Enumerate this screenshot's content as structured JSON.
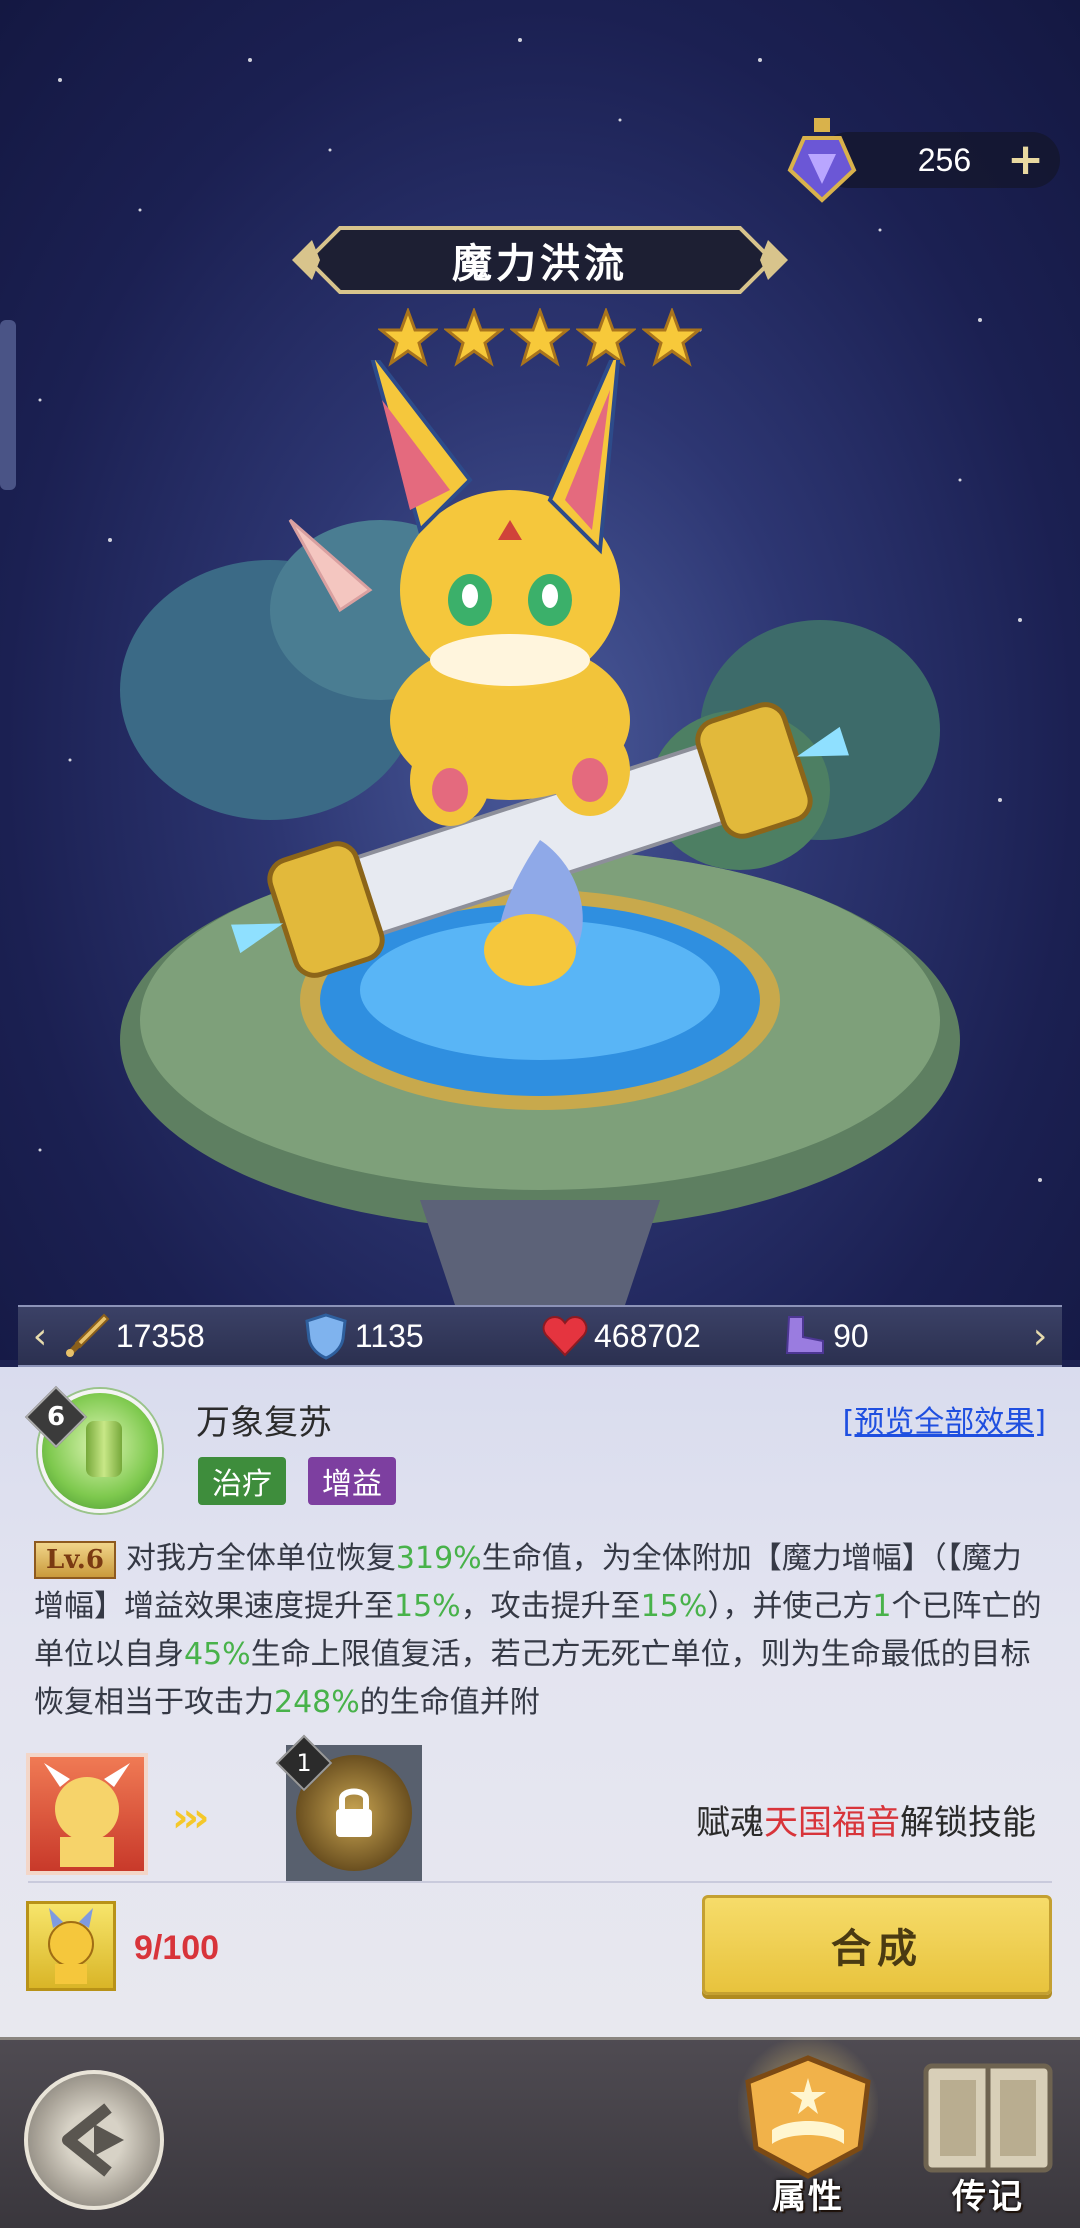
{
  "currency": {
    "amount": "256",
    "icon": "potion-icon",
    "plus_label": "+"
  },
  "hero": {
    "name": "魔力洪流",
    "stars": 5
  },
  "stats": [
    {
      "icon": "sword-icon",
      "value": "17358"
    },
    {
      "icon": "shield-icon",
      "value": "1135"
    },
    {
      "icon": "heart-icon",
      "value": "468702"
    },
    {
      "icon": "boot-icon",
      "value": "90"
    }
  ],
  "skill": {
    "level": "6",
    "name": "万象复苏",
    "preview_link": "[预览全部效果]",
    "tags": [
      "治疗",
      "增益"
    ],
    "lv_badge": "Lv.6",
    "desc": {
      "p1": "对我方全体单位恢复",
      "v1": "319%",
      "p2": "生命值，为全体附加【魔力增幅】（【魔力增幅】增益效果速度提升至",
      "v2": "15%",
      "p3": "，攻击提升至",
      "v3": "15%",
      "p4": "），并使己方",
      "v4": "1",
      "p5": "个已阵亡的单位以自身",
      "v5": "45%",
      "p6": "生命上限值复活，若己方无死亡单位，则为生命最低的目标恢复相当于攻击力",
      "v6": "248%",
      "p7": "的生命值并附"
    }
  },
  "soul": {
    "locked_level": "1",
    "unlock_prefix": "赋魂",
    "unlock_name": "天国福音",
    "unlock_suffix": "解锁技能"
  },
  "fragments": {
    "count": "9/100"
  },
  "compose_label": "合成",
  "nav": {
    "attr_label": "属性",
    "story_label": "传记"
  }
}
